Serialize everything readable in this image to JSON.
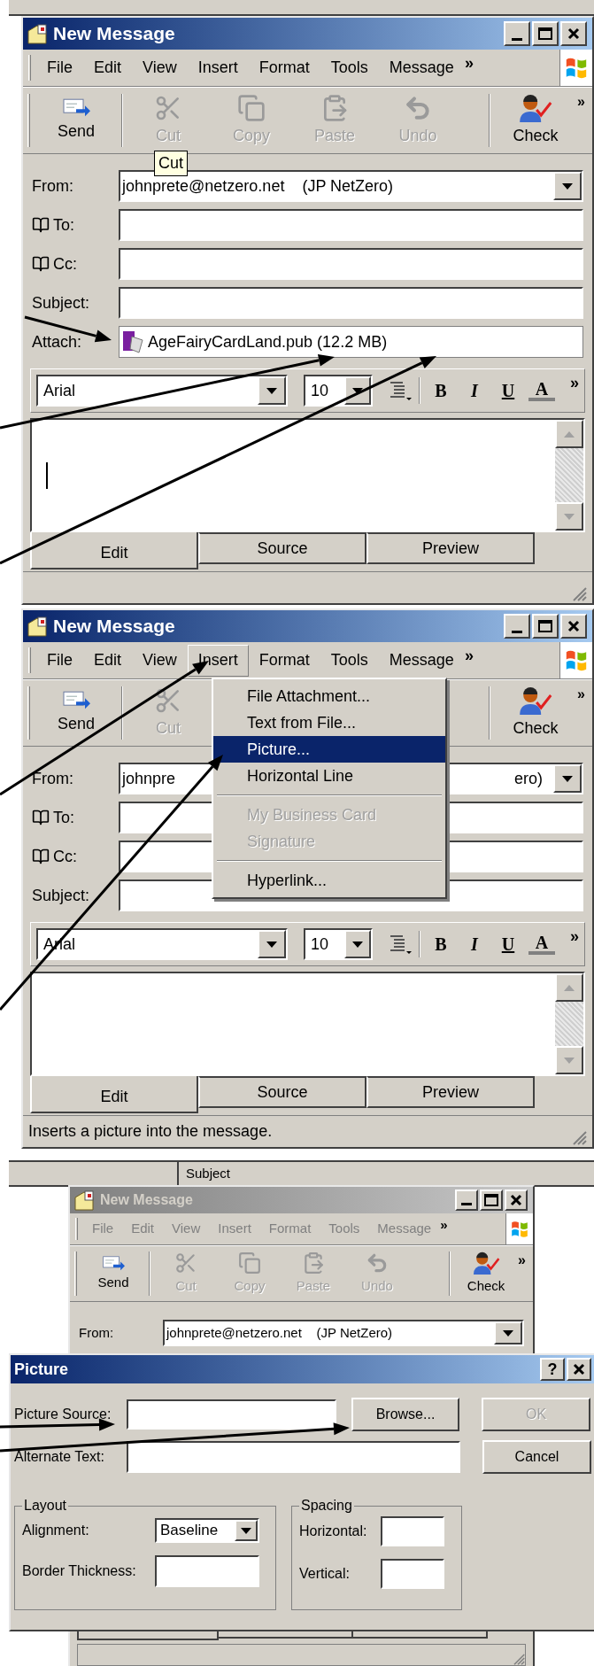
{
  "window_1": {
    "title": "New Message",
    "active": true,
    "menu": [
      {
        "label": "File",
        "selected": false
      },
      {
        "label": "Edit",
        "selected": false
      },
      {
        "label": "View",
        "selected": false
      },
      {
        "label": "Insert",
        "selected": false
      },
      {
        "label": "Format",
        "selected": false
      },
      {
        "label": "Tools",
        "selected": false
      },
      {
        "label": "Message",
        "selected": false
      }
    ],
    "menu_more": "»",
    "toolbar": [
      [
        {
          "label": "Send",
          "kind": "send",
          "disabled": false
        }
      ],
      [
        {
          "label": "Cut",
          "kind": "cut",
          "disabled": true
        },
        {
          "label": "Copy",
          "kind": "copy",
          "disabled": true
        },
        {
          "label": "Paste",
          "kind": "paste",
          "disabled": true
        },
        {
          "label": "Undo",
          "kind": "undo",
          "disabled": true
        }
      ],
      [
        {
          "label": "Check",
          "kind": "check",
          "disabled": false
        }
      ]
    ],
    "toolbar_more": "»",
    "tooltip": "Cut",
    "fields": [
      {
        "kind": "from",
        "label": "From:",
        "parts": [
          "johnprete@netzero.net    (JP NetZero)"
        ]
      },
      {
        "kind": "recipient",
        "label": "To:"
      },
      {
        "kind": "recipient",
        "label": "Cc:"
      },
      {
        "kind": "text",
        "label": "Subject:"
      },
      {
        "kind": "attachment",
        "label": "Attach:",
        "value": "AgeFairyCardLand.pub (12.2 MB)"
      }
    ],
    "format_bar": {
      "font": "Arial",
      "size": "10",
      "buttons": [
        "B",
        "I",
        "U",
        "A"
      ],
      "more": "»"
    },
    "editor": {
      "caret": true
    },
    "tabs": [
      {
        "label": "Edit",
        "selected": true
      },
      {
        "label": "Source",
        "selected": false
      },
      {
        "label": "Preview",
        "selected": false
      }
    ]
  },
  "window_2": {
    "title": "New Message",
    "active": true,
    "menu": [
      {
        "label": "File",
        "selected": false
      },
      {
        "label": "Edit",
        "selected": false
      },
      {
        "label": "View",
        "selected": false
      },
      {
        "label": "Insert",
        "selected": true
      },
      {
        "label": "Format",
        "selected": false
      },
      {
        "label": "Tools",
        "selected": false
      },
      {
        "label": "Message",
        "selected": false
      }
    ],
    "menu_more": "»",
    "toolbar": [
      [
        {
          "label": "Send",
          "kind": "send",
          "disabled": false
        }
      ],
      [
        {
          "label": "Cut",
          "kind": "cut",
          "disabled": true
        }
      ],
      [
        {
          "label": "Check",
          "kind": "check",
          "disabled": false
        }
      ]
    ],
    "toolbar_more": "»",
    "open_menu": [
      {
        "kind": "item",
        "label": "File Attachment...",
        "selected": false,
        "disabled": false
      },
      {
        "kind": "item",
        "label": "Text from File...",
        "selected": false,
        "disabled": false
      },
      {
        "kind": "item",
        "label": "Picture...",
        "selected": true,
        "disabled": false
      },
      {
        "kind": "item",
        "label": "Horizontal Line",
        "selected": false,
        "disabled": false
      },
      {
        "kind": "separator"
      },
      {
        "kind": "item",
        "label": "My Business Card",
        "selected": false,
        "disabled": true
      },
      {
        "kind": "item",
        "label": "Signature",
        "selected": false,
        "disabled": true
      },
      {
        "kind": "separator"
      },
      {
        "kind": "item",
        "label": "Hyperlink...",
        "selected": false,
        "disabled": false
      }
    ],
    "fields": [
      {
        "kind": "from",
        "label": "From:",
        "parts": [
          "johnpre",
          "ero)"
        ]
      },
      {
        "kind": "recipient",
        "label": "To:"
      },
      {
        "kind": "recipient",
        "label": "Cc:"
      },
      {
        "kind": "text",
        "label": "Subject:"
      }
    ],
    "format_bar": {
      "font": "Arial",
      "size": "10",
      "buttons": [
        "B",
        "I",
        "U",
        "A"
      ],
      "more": "»"
    },
    "editor": {
      "caret": false
    },
    "tabs": [
      {
        "label": "Edit",
        "selected": true
      },
      {
        "label": "Source",
        "selected": false
      },
      {
        "label": "Preview",
        "selected": false
      }
    ],
    "status": "Inserts a picture into the message."
  },
  "list_header": {
    "column": "Subject"
  },
  "window_3": {
    "title": "New Message",
    "active": false,
    "menu": [
      {
        "label": "File",
        "selected": false
      },
      {
        "label": "Edit",
        "selected": false
      },
      {
        "label": "View",
        "selected": false
      },
      {
        "label": "Insert",
        "selected": false
      },
      {
        "label": "Format",
        "selected": false
      },
      {
        "label": "Tools",
        "selected": false
      },
      {
        "label": "Message",
        "selected": false
      }
    ],
    "menu_more": "»",
    "toolbar": [
      [
        {
          "label": "Send",
          "kind": "send",
          "disabled": false
        }
      ],
      [
        {
          "label": "Cut",
          "kind": "cut",
          "disabled": true
        },
        {
          "label": "Copy",
          "kind": "copy",
          "disabled": true
        },
        {
          "label": "Paste",
          "kind": "paste",
          "disabled": true
        },
        {
          "label": "Undo",
          "kind": "undo",
          "disabled": true
        }
      ],
      [
        {
          "label": "Check",
          "kind": "check",
          "disabled": false
        }
      ]
    ],
    "toolbar_more": "»",
    "fields": [
      {
        "kind": "from",
        "label": "From:",
        "parts": [
          "johnprete@netzero.net    (JP NetZero)"
        ]
      }
    ]
  },
  "picture_dialog": {
    "title": "Picture",
    "help": "?",
    "source_label": "Picture Source:",
    "browse": "Browse...",
    "alt_label": "Alternate Text:",
    "buttons": [
      {
        "label": "OK",
        "disabled": true
      },
      {
        "label": "Cancel",
        "disabled": false
      }
    ],
    "layout": {
      "legend": "Layout",
      "alignment_label": "Alignment:",
      "alignment_value": "Baseline",
      "border_label": "Border Thickness:"
    },
    "spacing": {
      "legend": "Spacing",
      "horizontal_label": "Horizontal:",
      "vertical_label": "Vertical:"
    }
  }
}
